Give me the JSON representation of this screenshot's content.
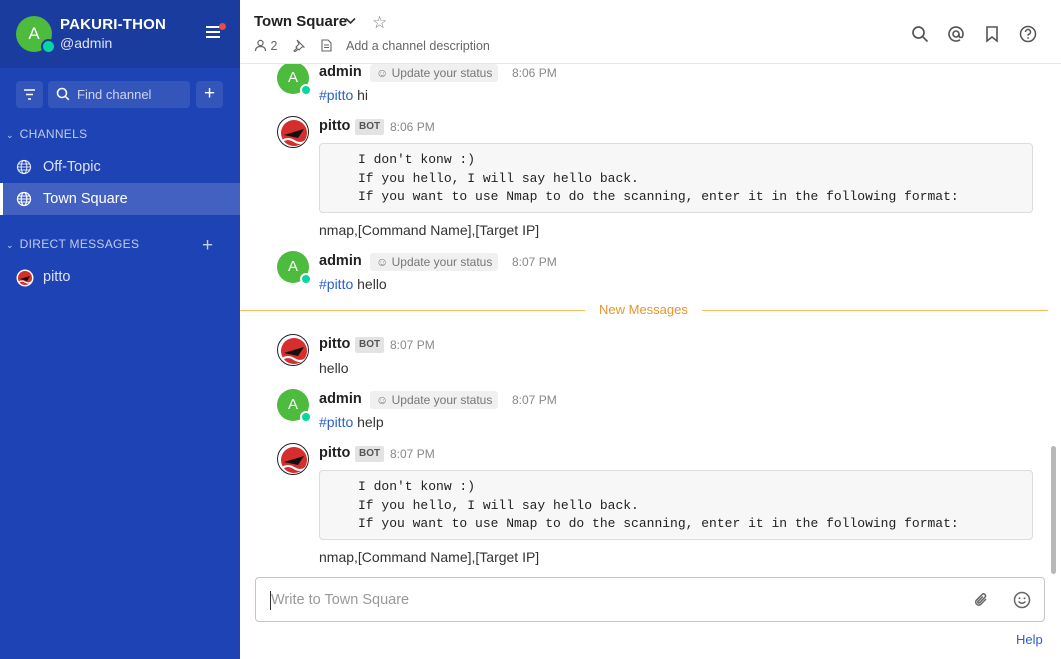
{
  "team": {
    "initial": "A",
    "name": "PAKURI-THON",
    "user": "@admin"
  },
  "sidebar": {
    "find_placeholder": "Find channel",
    "channels_header": "CHANNELS",
    "channels": [
      {
        "label": "Off-Topic"
      },
      {
        "label": "Town Square",
        "active": true
      }
    ],
    "dm_header": "DIRECT MESSAGES",
    "dms": [
      {
        "label": "pitto"
      }
    ]
  },
  "header": {
    "channel": "Town Square",
    "members": "2",
    "description_placeholder": "Add a channel description"
  },
  "status_label": "Update your status",
  "bot_badge": "BOT",
  "posts": [
    {
      "user": "admin",
      "time": "8:06 PM",
      "mention": "#pitto",
      "text": "hi"
    },
    {
      "user": "pitto",
      "time": "8:06 PM",
      "code": "I don't konw :)\nIf you hello, I will say hello back.\nIf you want to use Nmap to do the scanning, enter it in the following format:",
      "after": "nmap,[Command Name],[Target IP]"
    },
    {
      "user": "admin",
      "time": "8:07 PM",
      "mention": "#pitto",
      "text": "hello"
    },
    {
      "user": "pitto",
      "time": "8:07 PM",
      "text": "hello"
    },
    {
      "user": "admin",
      "time": "8:07 PM",
      "mention": "#pitto",
      "text": "help"
    },
    {
      "user": "pitto",
      "time": "8:07 PM",
      "code": "I don't konw :)\nIf you hello, I will say hello back.\nIf you want to use Nmap to do the scanning, enter it in the following format:",
      "after": "nmap,[Command Name],[Target IP]"
    }
  ],
  "new_messages_label": "New Messages",
  "composer": {
    "placeholder": "Write to Town Square"
  },
  "help_link": "Help",
  "colors": {
    "sidebar": "#1e43b4",
    "accent": "#2a5fcc",
    "online": "#06d6a0",
    "new_messages": "#f5a623"
  }
}
